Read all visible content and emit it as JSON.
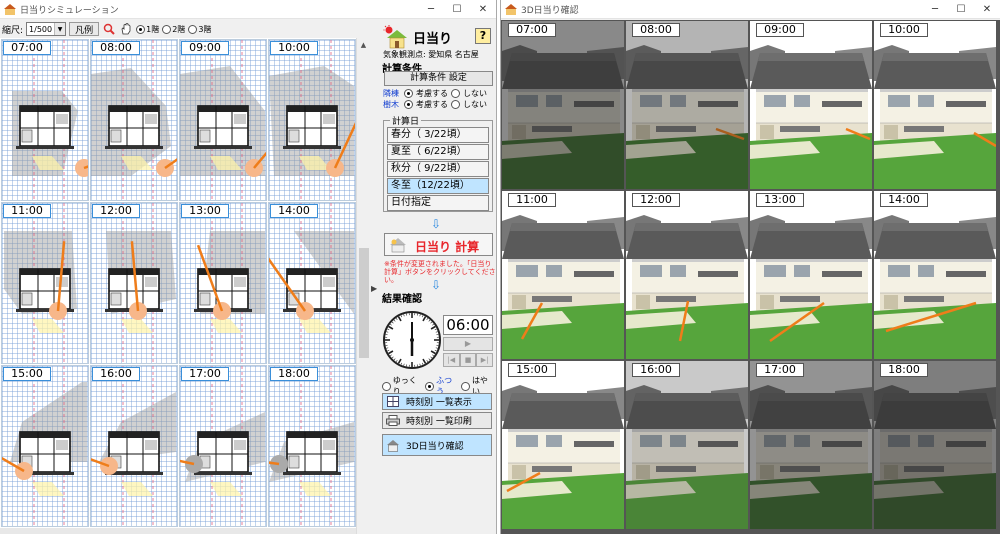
{
  "window_plan": {
    "title": "日当りシミュレーション",
    "min": "─",
    "max": "☐",
    "close": "✕"
  },
  "toolbar": {
    "scale_label": "縮尺:",
    "scale_value": "1/500",
    "legend_button": "凡例",
    "floor1": "1階",
    "floor2": "2階",
    "floor3": "3階"
  },
  "plan_times": [
    "07:00",
    "08:00",
    "09:00",
    "10:00",
    "11:00",
    "12:00",
    "13:00",
    "14:00",
    "15:00",
    "16:00",
    "17:00",
    "18:00"
  ],
  "panel": {
    "title": "日当り",
    "help": "?",
    "observation": "気象観測点: 愛知県 名古屋",
    "calc_conditions_heading": "計算条件",
    "calc_conditions_button": "計算条件 設定",
    "neighbor_label": "隣棟",
    "tree_label": "樹木",
    "consider": "考慮する",
    "not_consider": "しない",
    "calc_date_label": "計算日",
    "dates": [
      {
        "label": "春分（ 3/22頃）",
        "active": false
      },
      {
        "label": "夏至（ 6/22頃）",
        "active": false
      },
      {
        "label": "秋分（ 9/22頃）",
        "active": false
      },
      {
        "label": "冬至（12/22頃）",
        "active": true
      },
      {
        "label": "日付指定",
        "active": false
      }
    ],
    "calc_button": "日当り 計算",
    "note": "※条件が変更されました。「日当り計算」ボタンをクリックしてください。",
    "result_heading": "結果確認",
    "time_display": "06:00",
    "speed_slow": "ゆっくり",
    "speed_normal": "ふつう",
    "speed_fast": "はやい",
    "list_view_button": "時刻別 一覧表示",
    "list_print_button": "時刻別 一覧印刷",
    "view3d_button": "3D日当り確認"
  },
  "window_3d": {
    "title": "3D日当り確認",
    "min": "─",
    "max": "☐",
    "close": "✕"
  },
  "scene_times": [
    "07:00",
    "08:00",
    "09:00",
    "10:00",
    "11:00",
    "12:00",
    "13:00",
    "14:00",
    "15:00",
    "16:00",
    "17:00",
    "18:00"
  ],
  "colors": {
    "sun_ray": "#ef7d1a",
    "shadow": "#9a9a9a",
    "sun_disc": "#f7b78a",
    "grass": "#56a53c",
    "accent_blue": "#3a8fd9",
    "warning_red": "#e8262b"
  }
}
